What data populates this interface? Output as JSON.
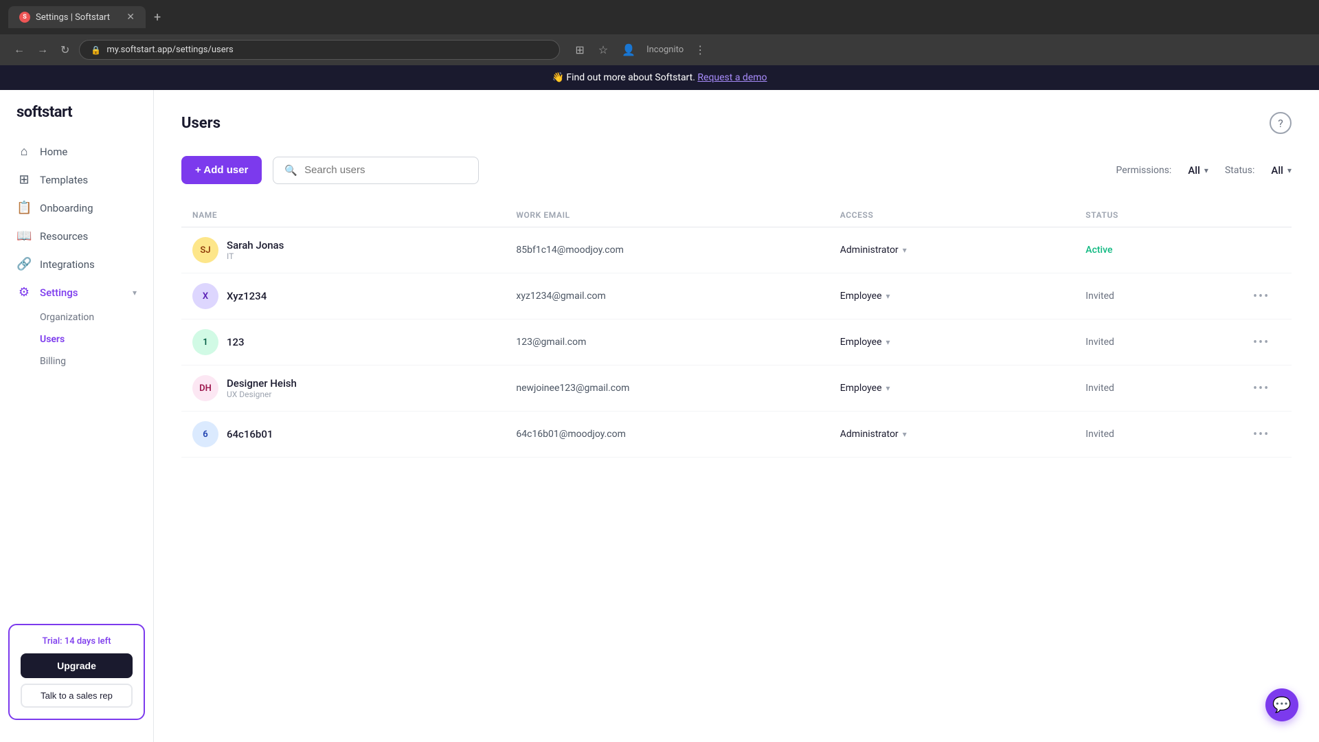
{
  "browser": {
    "tab_title": "Settings | Softstart",
    "tab_favicon": "S",
    "url": "my.softstart.app/settings/users",
    "new_tab_label": "+",
    "nav_back": "←",
    "nav_forward": "→",
    "nav_refresh": "↻",
    "incognito_label": "Incognito",
    "lock_icon": "🔒"
  },
  "banner": {
    "text": "👋 Find out more about Softstart.",
    "link_text": "Request a demo"
  },
  "sidebar": {
    "logo": "softstart",
    "nav_items": [
      {
        "id": "home",
        "label": "Home",
        "icon": "⌂"
      },
      {
        "id": "templates",
        "label": "Templates",
        "icon": "⊞"
      },
      {
        "id": "onboarding",
        "label": "Onboarding",
        "icon": "📋"
      },
      {
        "id": "resources",
        "label": "Resources",
        "icon": "📖"
      },
      {
        "id": "integrations",
        "label": "Integrations",
        "icon": "⚙"
      },
      {
        "id": "settings",
        "label": "Settings",
        "icon": "⚙",
        "expanded": true
      }
    ],
    "settings_submenu": [
      {
        "id": "organization",
        "label": "Organization"
      },
      {
        "id": "users",
        "label": "Users",
        "active": true
      },
      {
        "id": "billing",
        "label": "Billing"
      }
    ],
    "trial_text": "Trial: 14 days left",
    "upgrade_label": "Upgrade",
    "sales_label": "Talk to a sales rep"
  },
  "page": {
    "title": "Users",
    "help_icon": "?",
    "add_user_label": "+ Add user",
    "search_placeholder": "Search users",
    "permissions_label": "Permissions:",
    "permissions_value": "All",
    "status_label": "Status:",
    "status_value": "All",
    "table_columns": [
      {
        "id": "name",
        "label": "NAME"
      },
      {
        "id": "email",
        "label": "WORK EMAIL"
      },
      {
        "id": "access",
        "label": "ACCESS"
      },
      {
        "id": "status",
        "label": "STATUS"
      }
    ],
    "users": [
      {
        "id": 1,
        "initials": "SJ",
        "avatar_class": "sj",
        "name": "Sarah Jonas",
        "dept": "IT",
        "email": "85bf1c14@moodjoy.com",
        "access": "Administrator",
        "access_icon": "▾",
        "status": "Active",
        "status_class": "active",
        "has_more": false
      },
      {
        "id": 2,
        "initials": "X",
        "avatar_class": "x",
        "name": "Xyz1234",
        "dept": "",
        "email": "xyz1234@gmail.com",
        "access": "Employee",
        "access_icon": "▾",
        "status": "Invited",
        "status_class": "invited",
        "has_more": true
      },
      {
        "id": 3,
        "initials": "1",
        "avatar_class": "one",
        "name": "123",
        "dept": "",
        "email": "123@gmail.com",
        "access": "Employee",
        "access_icon": "▾",
        "status": "Invited",
        "status_class": "invited",
        "has_more": true
      },
      {
        "id": 4,
        "initials": "DH",
        "avatar_class": "dh",
        "name": "Designer Heish",
        "dept": "UX Designer",
        "email": "newjoinee123@gmail.com",
        "access": "Employee",
        "access_icon": "▾",
        "status": "Invited",
        "status_class": "invited",
        "has_more": true
      },
      {
        "id": 5,
        "initials": "6",
        "avatar_class": "six",
        "name": "64c16b01",
        "dept": "",
        "email": "64c16b01@moodjoy.com",
        "access": "Administrator",
        "access_icon": "▾",
        "status": "Invited",
        "status_class": "invited",
        "has_more": true
      }
    ],
    "more_icon": "•••"
  }
}
